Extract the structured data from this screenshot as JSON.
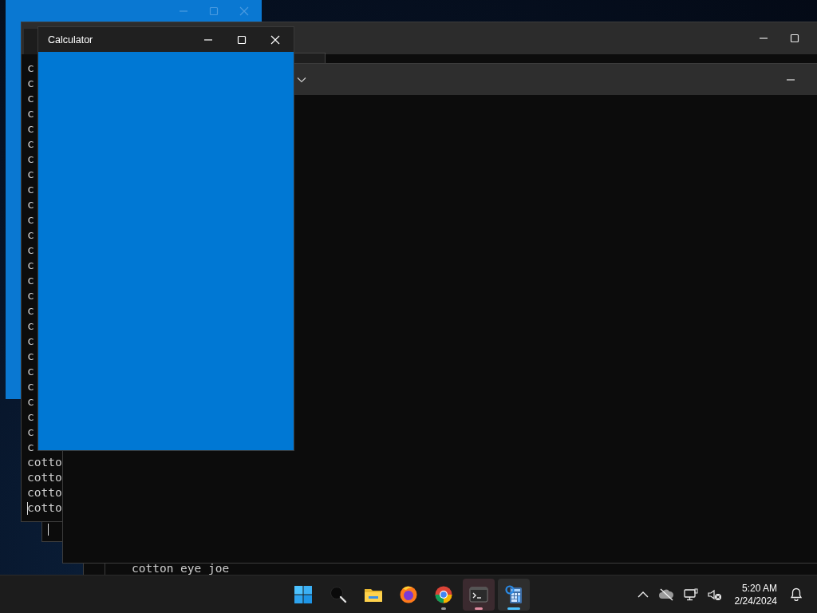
{
  "terminal_back": {
    "lines": [
      {
        "text": "c",
        "cursor": false
      },
      {
        "text": "c",
        "cursor": false
      },
      {
        "text": "c",
        "cursor": false
      },
      {
        "text": "c",
        "cursor": false
      },
      {
        "text": "c",
        "cursor": false
      },
      {
        "text": "c",
        "cursor": false
      },
      {
        "text": "c",
        "cursor": false
      },
      {
        "text": "c",
        "cursor": false
      },
      {
        "text": "c",
        "cursor": false
      },
      {
        "text": "c",
        "cursor": false
      },
      {
        "text": "c",
        "cursor": false
      },
      {
        "text": "c",
        "cursor": false
      },
      {
        "text": "c",
        "cursor": false
      },
      {
        "text": "c",
        "cursor": false
      },
      {
        "text": "c",
        "cursor": false
      },
      {
        "text": "c",
        "cursor": false
      },
      {
        "text": "c",
        "cursor": false
      },
      {
        "text": "c",
        "cursor": false
      },
      {
        "text": "c",
        "cursor": false
      },
      {
        "text": "c",
        "cursor": false
      },
      {
        "text": "c",
        "cursor": false
      },
      {
        "text": "c",
        "cursor": false
      },
      {
        "text": "c",
        "cursor": false
      },
      {
        "text": "c",
        "cursor": false
      },
      {
        "text": "c",
        "cursor": false
      },
      {
        "text": "c",
        "cursor": false
      },
      {
        "text": "cotto",
        "cursor": false
      },
      {
        "text": "cotto",
        "cursor": false
      },
      {
        "text": "cotto",
        "cursor": false
      },
      {
        "text": "cotto",
        "cursor": true
      }
    ]
  },
  "terminal_small": {
    "lines": [
      {
        "text": "cotton eye joe"
      }
    ]
  },
  "calculator": {
    "title": "Calculator"
  },
  "taskbar": {
    "apps": [
      {
        "kind": "start",
        "running": false,
        "focused": false,
        "attention": false
      },
      {
        "kind": "search",
        "running": false,
        "focused": false,
        "attention": false
      },
      {
        "kind": "files",
        "running": false,
        "focused": false,
        "attention": false
      },
      {
        "kind": "firefox",
        "running": false,
        "focused": false,
        "attention": false
      },
      {
        "kind": "chrome",
        "running": true,
        "focused": false,
        "attention": false
      },
      {
        "kind": "terminal",
        "running": true,
        "focused": false,
        "attention": true
      },
      {
        "kind": "calculator",
        "running": true,
        "focused": true,
        "attention": false
      }
    ],
    "clock_time": "5:20 AM",
    "clock_date": "2/24/2024"
  }
}
